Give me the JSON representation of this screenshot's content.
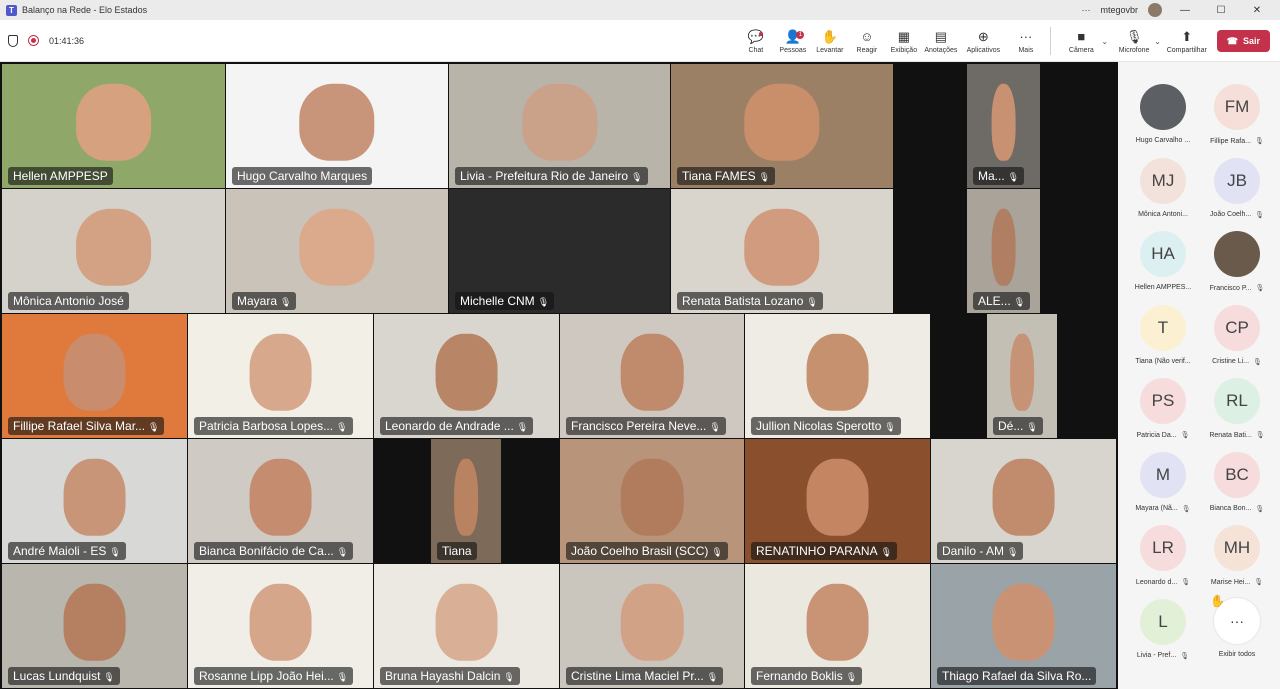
{
  "window": {
    "title": "Balanço na Rede - Elo Estados",
    "user": "mtegovbr",
    "more": "···",
    "minimize": "—",
    "maximize": "☐",
    "close": "✕"
  },
  "meeting": {
    "elapsed": "01:41:36",
    "toolbar": {
      "chat": "Chat",
      "people": "Pessoas",
      "people_badge": "1",
      "raise": "Levantar",
      "react": "Reagir",
      "view": "Exibição",
      "notes": "Anotações",
      "apps": "Aplicativos",
      "more": "Mais",
      "camera": "Câmera",
      "mic": "Microfone",
      "share": "Compartilhar",
      "leave": "Sair"
    }
  },
  "tiles": [
    {
      "name": "Hellen AMPPESP",
      "mic": false,
      "bg": "#8fa86a",
      "skin": "#d6a17f"
    },
    {
      "name": "Hugo Carvalho Marques",
      "mic": false,
      "bg": "#f4f4f4",
      "skin": "#c9957a"
    },
    {
      "name": "Livia - Prefeitura Rio de Janeiro",
      "mic": true,
      "bg": "#b9b4aa",
      "skin": "#caa189"
    },
    {
      "name": "Tiana FAMES",
      "mic": true,
      "bg": "#9c8066",
      "skin": "#c98f6b"
    },
    {
      "name": "Ma...",
      "mic": true,
      "bg": "#6e6b66",
      "skin": "#c89272"
    },
    {
      "name": "Mônica Antonio José",
      "mic": false,
      "bg": "#d5d2cc",
      "skin": "#d3a284"
    },
    {
      "name": "Mayara",
      "mic": true,
      "bg": "#c9c3b9",
      "skin": "#dbaa8c"
    },
    {
      "name": "Michelle CNM",
      "mic": true,
      "bg": "#2b2b2b",
      "skin": "#2b2b2b"
    },
    {
      "name": "Renata Batista Lozano",
      "mic": true,
      "bg": "#dad5cc",
      "skin": "#d09b7e"
    },
    {
      "name": "ALE...",
      "mic": true,
      "bg": "#a9a399",
      "skin": "#b07e63"
    },
    {
      "name": "Fillipe Rafael Silva Mar...",
      "mic": true,
      "bg": "#e07a3c",
      "skin": "#c98c6c"
    },
    {
      "name": "Patricia Barbosa Lopes...",
      "mic": true,
      "bg": "#f1efe6",
      "skin": "#d7a88c"
    },
    {
      "name": "Leonardo de Andrade ...",
      "mic": true,
      "bg": "#d9d6cf",
      "skin": "#b98567"
    },
    {
      "name": "Francisco Pereira Neve...",
      "mic": true,
      "bg": "#cfc8c0",
      "skin": "#c08a6c"
    },
    {
      "name": "Jullion Nicolas Sperotto",
      "mic": true,
      "bg": "#eeece4",
      "skin": "#c6916f"
    },
    {
      "name": "Dé...",
      "mic": true,
      "bg": "#c3bfb5",
      "skin": "#c69376"
    },
    {
      "name": "André Maioli - ES",
      "mic": true,
      "bg": "#d8d8d6",
      "skin": "#c99579"
    },
    {
      "name": "Bianca Bonifácio de Ca...",
      "mic": true,
      "bg": "#cfcbc4",
      "skin": "#c58c70"
    },
    {
      "name": "Tiana",
      "mic": false,
      "bg": "#7d6a58",
      "skin": "#b98261"
    },
    {
      "name": "João Coelho Brasil (SCC)",
      "mic": true,
      "bg": "#b8957a",
      "skin": "#b17c5d"
    },
    {
      "name": "RENATINHO PARANA",
      "mic": true,
      "bg": "#8a4f2c",
      "skin": "#c48563"
    },
    {
      "name": "Danilo - AM",
      "mic": true,
      "bg": "#d8d5ce",
      "skin": "#c18c6d"
    },
    {
      "name": "Lucas Lundquist",
      "mic": true,
      "bg": "#b9b6ad",
      "skin": "#b57f61"
    },
    {
      "name": "Rosanne Lipp João Hei...",
      "mic": true,
      "bg": "#f0eee7",
      "skin": "#d5a68a"
    },
    {
      "name": "Bruna Hayashi Dalcin",
      "mic": true,
      "bg": "#ece9e2",
      "skin": "#d9b095"
    },
    {
      "name": "Cristine Lima Maciel Pr...",
      "mic": true,
      "bg": "#cac6bd",
      "skin": "#d1a286"
    },
    {
      "name": "Fernando Boklis",
      "mic": true,
      "bg": "#ebe8e0",
      "skin": "#c99475"
    },
    {
      "name": "Thiago Rafael da Silva Ro...",
      "mic": false,
      "bg": "#9aa3a8",
      "skin": "#c99274"
    }
  ],
  "panel": {
    "people": [
      {
        "initials": "",
        "name": "Hugo Carvalho ...",
        "mic": false,
        "bg": "#5c5f63"
      },
      {
        "initials": "FM",
        "name": "Fillipe Rafa...",
        "mic": true,
        "bg": "#f6dfd8"
      },
      {
        "initials": "MJ",
        "name": "Mônica Antoni...",
        "mic": false,
        "bg": "#f3e2dc"
      },
      {
        "initials": "JB",
        "name": "João Coelh...",
        "mic": true,
        "bg": "#e1e3f4"
      },
      {
        "initials": "HA",
        "name": "Hellen AMPPES...",
        "mic": false,
        "bg": "#dcf0f2"
      },
      {
        "initials": "",
        "name": "Francisco P...",
        "mic": true,
        "bg": "#6a5a4c"
      },
      {
        "initials": "T",
        "name": "Tiana (Não verif...",
        "mic": false,
        "bg": "#fbf0d2"
      },
      {
        "initials": "CP",
        "name": "Cristine Li...",
        "mic": true,
        "bg": "#f6dcdc"
      },
      {
        "initials": "PS",
        "name": "Patricia Da...",
        "mic": true,
        "bg": "#f6dcdc"
      },
      {
        "initials": "RL",
        "name": "Renata Bati...",
        "mic": true,
        "bg": "#dcf0e4"
      },
      {
        "initials": "M",
        "name": "Mayara (Nã...",
        "mic": true,
        "bg": "#e1e3f4"
      },
      {
        "initials": "BC",
        "name": "Bianca Bon...",
        "mic": true,
        "bg": "#f6dcdc"
      },
      {
        "initials": "LR",
        "name": "Leonardo d...",
        "mic": true,
        "bg": "#f6dcdc"
      },
      {
        "initials": "MH",
        "name": "Marise Hei...",
        "mic": true,
        "bg": "#f6e3d8"
      },
      {
        "initials": "L",
        "name": "Livia - Pref...",
        "mic": true,
        "bg": "#e3f0d8"
      }
    ],
    "view_all": "Exibir todos",
    "view_all_icon": "···",
    "raised_hand": "✋"
  }
}
